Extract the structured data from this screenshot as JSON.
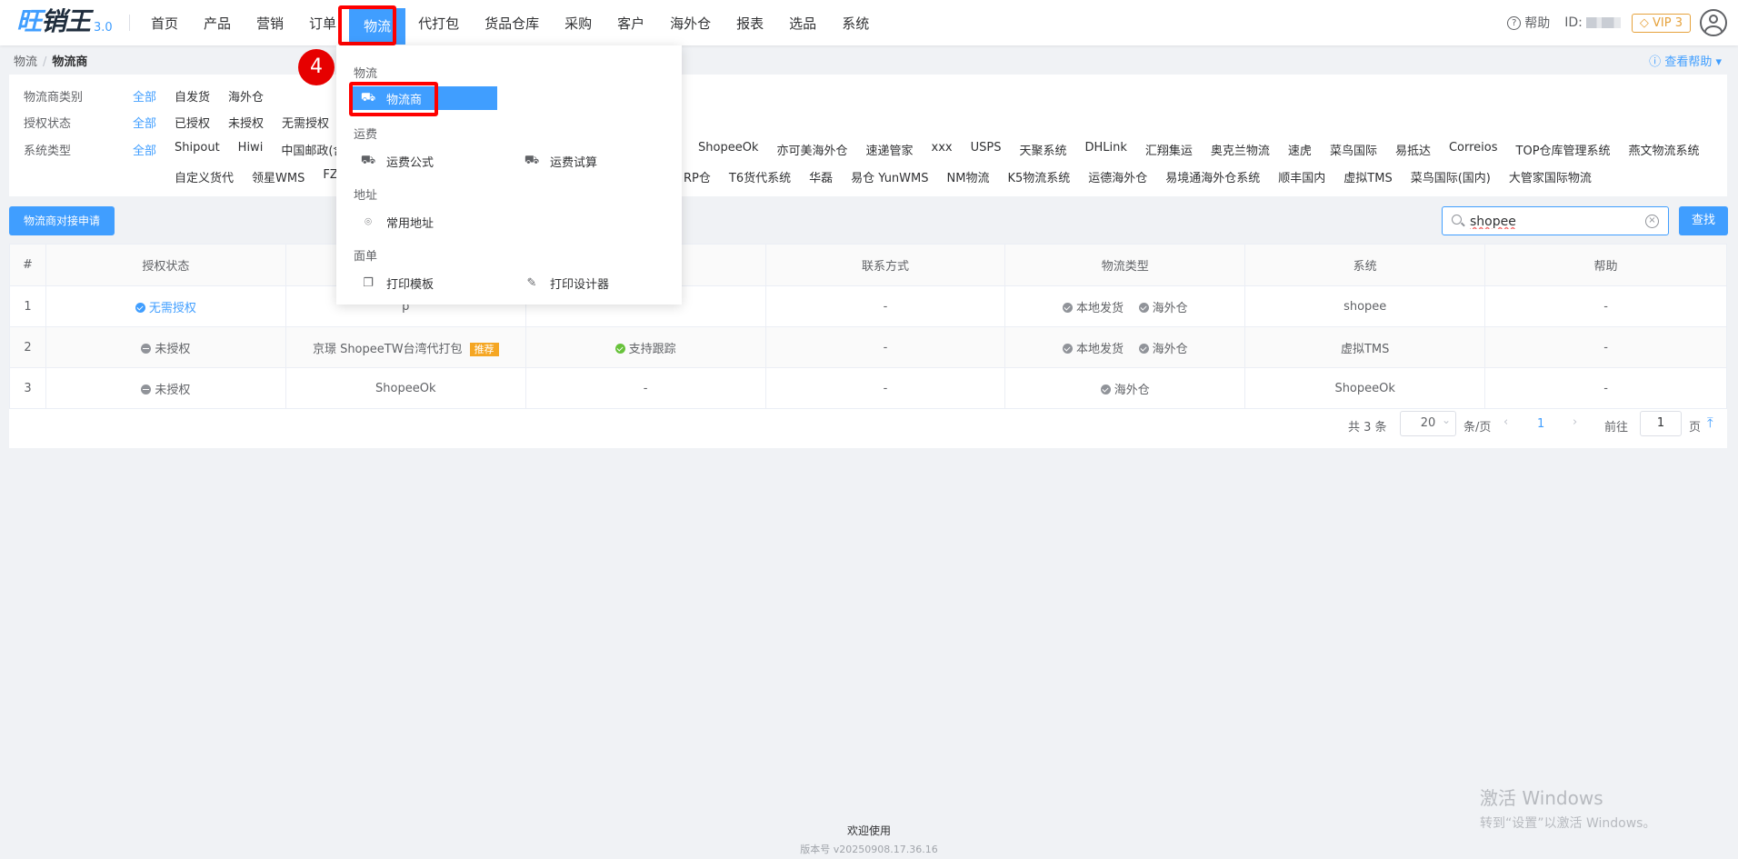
{
  "app": {
    "brand_a": "旺",
    "brand_b": "销王",
    "version": "3.0"
  },
  "nav": [
    {
      "label": "首页"
    },
    {
      "label": "产品"
    },
    {
      "label": "营销"
    },
    {
      "label": "订单"
    },
    {
      "label": "物流"
    },
    {
      "label": "代打包"
    },
    {
      "label": "货品仓库"
    },
    {
      "label": "采购"
    },
    {
      "label": "客户"
    },
    {
      "label": "海外仓"
    },
    {
      "label": "报表"
    },
    {
      "label": "选品"
    },
    {
      "label": "系统"
    }
  ],
  "header": {
    "help": "帮助",
    "id_label": "ID:",
    "vip": "VIP 3"
  },
  "breadcrumb": {
    "root": "物流",
    "sep": "/",
    "current": "物流商"
  },
  "help_right": "查看帮助",
  "filters": {
    "category": {
      "label": "物流商类别",
      "options": [
        "全部",
        "自发货",
        "海外仓"
      ]
    },
    "auth": {
      "label": "授权状态",
      "options": [
        "全部",
        "已授权",
        "未授权",
        "无需授权"
      ]
    },
    "systype": {
      "label": "系统类型",
      "row1": [
        "全部",
        "Shipout",
        "Hiwi",
        "中国邮政(含"
      ],
      "row1b": [
        "ShopeeOk",
        "亦可美海外仓",
        "速递管家",
        "xxx",
        "USPS",
        "天聚系统",
        "DHLink",
        "汇翔集运",
        "奥克兰物流",
        "速虎",
        "菜鸟国际",
        "易抵达",
        "Correios",
        "TOP仓库管理系统",
        "燕文物流系统"
      ],
      "row2a": [
        "自定义货代",
        "领星WMS",
        "FZ"
      ],
      "row2b": [
        "RP仓",
        "T6货代系统",
        "华磊",
        "易仓 YunWMS",
        "NM物流",
        "K5物流系统",
        "运德海外仓",
        "易境通海外仓系统",
        "顺丰国内",
        "虚拟TMS",
        "菜鸟国际(国内)",
        "大管家国际物流"
      ]
    }
  },
  "actions": {
    "apply": "物流商对接申请",
    "search_value": "shopee",
    "find": "查找"
  },
  "table": {
    "headers": [
      "#",
      "授权状态",
      "",
      "",
      "联系方式",
      "物流类型",
      "系统",
      "帮助"
    ],
    "rows": [
      {
        "no": "1",
        "auth": "无需授权",
        "name": "p",
        "track": "",
        "contact": "-",
        "types": [
          "本地发货",
          "海外仓"
        ],
        "system": "shopee",
        "help": "-"
      },
      {
        "no": "2",
        "auth": "未授权",
        "name": "京璟 ShopeeTW台湾代打包",
        "badge": "推荐",
        "track": "支持跟踪",
        "contact": "-",
        "types": [
          "本地发货",
          "海外仓"
        ],
        "system": "虚拟TMS",
        "help": "-"
      },
      {
        "no": "3",
        "auth": "未授权",
        "name": "ShopeeOk",
        "track": "-",
        "contact": "-",
        "types": [
          "海外仓"
        ],
        "system": "ShopeeOk",
        "help": "-"
      }
    ]
  },
  "pager": {
    "total": "共 3 条",
    "size": "20",
    "unit": "条/页",
    "current": "1",
    "goto": "前往",
    "goto_value": "1",
    "page": "页"
  },
  "dropdown": {
    "g1": "物流",
    "i1": "物流商",
    "g2": "运费",
    "i2": "运费公式",
    "i3": "运费试算",
    "g3": "地址",
    "i4": "常用地址",
    "g4": "面单",
    "i5": "打印模板",
    "i6": "打印设计器"
  },
  "step": "4",
  "footer": {
    "welcome": "欢迎使用",
    "version": "版本号 v20250908.17.36.16"
  },
  "windows": {
    "line1": "激活 Windows",
    "line2": "转到“设置”以激活 Windows。"
  },
  "colors": {
    "primary": "#409eff",
    "highlight": "#ff0000",
    "badge": "#f5a623"
  }
}
